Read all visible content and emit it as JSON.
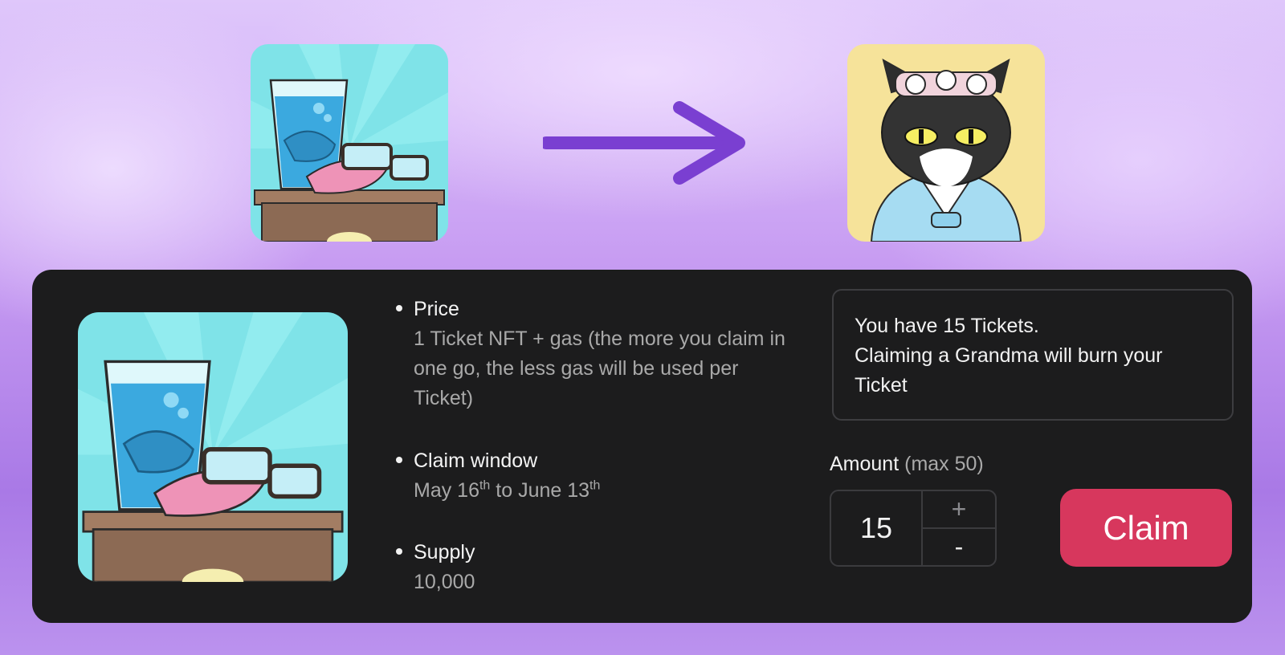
{
  "transform": {
    "before_image": "ticket-nft-dentures-glasses",
    "arrow_icon": "arrow-right-icon",
    "after_image": "grandma-cat-nft",
    "arrow_color": "#7a3fd1"
  },
  "panel": {
    "image": "ticket-nft-dentures-glasses",
    "info": [
      {
        "title": "Price",
        "value": "1 Ticket NFT + gas (the more you claim in one go, the less gas will be used per Ticket)"
      },
      {
        "title": "Claim window",
        "value_parts": {
          "start": "May 16",
          "start_suffix": "th",
          "mid": " to June 13",
          "end_suffix": "th"
        }
      },
      {
        "title": "Supply",
        "value": "10,000"
      }
    ],
    "notice": {
      "line1": "You have 15 Tickets.",
      "line2": "Claiming a Grandma will burn your",
      "line3": "Ticket"
    },
    "amount": {
      "label": "Amount",
      "max": "(max 50)",
      "value": "15",
      "increment": "+",
      "decrement": "-"
    },
    "claim_button": "Claim"
  },
  "colors": {
    "panel_bg": "#1c1c1d",
    "claim_button": "#d7375d",
    "muted_text": "#a9a9a9"
  }
}
